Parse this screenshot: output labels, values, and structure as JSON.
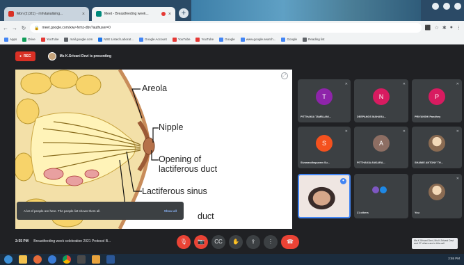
{
  "browser": {
    "tabs": [
      {
        "title": "Mon (2,021) - mhvtanalising...",
        "close": "×"
      },
      {
        "title": "Meet - Breastfeeding week...",
        "close": "×"
      }
    ],
    "new_tab": "+",
    "url": "meet.google.com/xwv-fvmz-dbv?authuser=0",
    "bookmarks": [
      "Apps",
      "Drive",
      "YouTube",
      "mail.google.com",
      "NSE Listed Laborat...",
      "Google Account",
      "YouTube",
      "YouTube",
      "Google",
      "www.google.search...",
      "Google",
      "Reading list"
    ]
  },
  "meet": {
    "rec_label": "REC",
    "presenting_text": "Ms K.Srivani Devi is presenting",
    "slide": {
      "labels": {
        "areola": "Areola",
        "nipple": "Nipple",
        "opening1": "Opening of",
        "opening2": "lactiferous duct",
        "sinus": "Lactiferous sinus",
        "duct": "duct"
      }
    },
    "toast": {
      "message": "A lot of people are here. The people list shows them all.",
      "action": "Show all"
    },
    "tiles": [
      {
        "initial": "T",
        "name": "PITTHAKIA TAMBLANI...",
        "color": "#8e24aa"
      },
      {
        "initial": "N",
        "name": "DEEPANGS MAHARA...",
        "color": "#d81b60"
      },
      {
        "initial": "P",
        "name": "PRIYANSHI Pandhey",
        "color": "#d81b60"
      },
      {
        "initial": "S",
        "name": "Sivanandhapuram Su...",
        "color": "#f4511e"
      },
      {
        "initial": "A",
        "name": "PITTHAKIA ANKARA...",
        "color": "#8d6e63"
      },
      {
        "initial": "",
        "name": "SHAMIE ANTONY TH...",
        "color": ""
      },
      {
        "initial": "",
        "name": "",
        "color": ""
      },
      {
        "initial": "",
        "name": "21 others",
        "color": ""
      },
      {
        "initial": "",
        "name": "You",
        "color": ""
      }
    ],
    "meeting_time": "2:55 PM",
    "meeting_title": "Breastfeeding week celebration 2021 Protocol B...",
    "tooltip": "Ms K.Srivani Devi, Ms K.Srivani Devi and 27 others are in this call"
  },
  "taskbar": {
    "time": "2:55 PM"
  },
  "colors": {
    "meet_bg": "#202124",
    "tile_bg": "#3c4043",
    "end_call": "#ea4335",
    "accent": "#4285f4"
  }
}
